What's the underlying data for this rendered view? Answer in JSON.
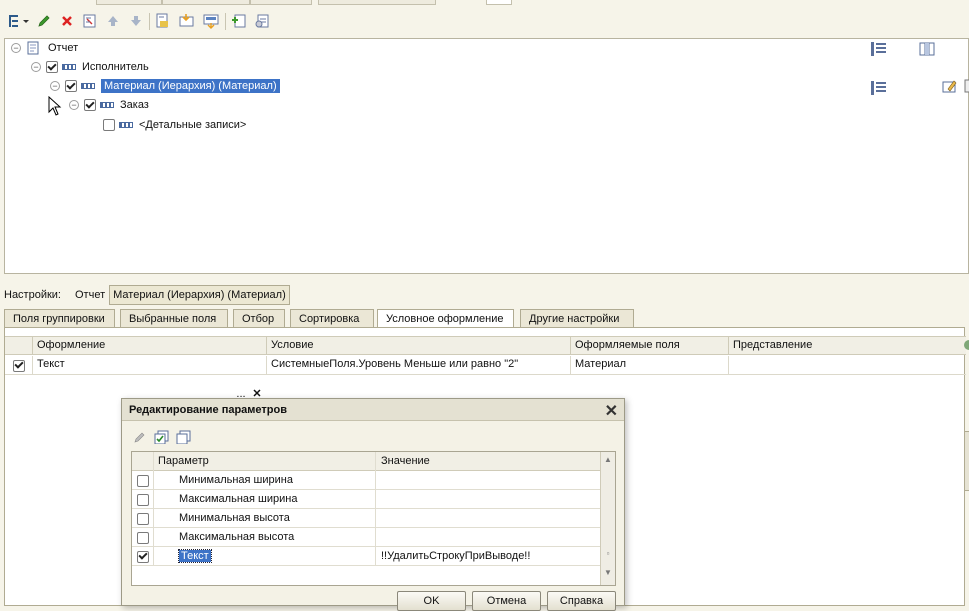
{
  "toolbar": {
    "icons": [
      "add-group-icon",
      "edit-icon",
      "delete-icon",
      "properties-icon",
      "move-up-icon",
      "move-down-icon",
      "group-icon",
      "ungroup-icon",
      "detail-icon",
      "expand-icon",
      "collapse-icon"
    ]
  },
  "tree": {
    "root": "Отчет",
    "nodes": [
      {
        "label": "Исполнитель",
        "checked": true
      },
      {
        "label": "Материал (Иерархия) (Материал)",
        "checked": true,
        "selected": true
      },
      {
        "label": "Заказ",
        "checked": true
      },
      {
        "label": "<Детальные записи>",
        "checked": false
      }
    ]
  },
  "settings": {
    "label": "Настройки:",
    "crumb1": "Отчет",
    "crumb2": "Материал (Иерархия) (Материал)"
  },
  "tabs": [
    {
      "label": "Поля группировки",
      "active": false
    },
    {
      "label": "Выбранные поля",
      "active": false
    },
    {
      "label": "Отбор",
      "active": false
    },
    {
      "label": "Сортировка",
      "active": false
    },
    {
      "label": "Условное оформление",
      "active": true
    },
    {
      "label": "Другие настройки",
      "active": false
    }
  ],
  "grid": {
    "headers": [
      "Оформление",
      "Условие",
      "Оформляемые поля",
      "Представление"
    ],
    "row": {
      "checked": true,
      "appearance": "Текст",
      "choose_btn": "...",
      "clear_btn": "✕",
      "condition": "СистемныеПоля.Уровень Меньше или равно \"2\"",
      "fields": "Материал",
      "presentation": ""
    }
  },
  "dialog": {
    "title": "Редактирование параметров",
    "close": "✕",
    "headers": [
      "Параметр",
      "Значение"
    ],
    "rows": [
      {
        "param": "Минимальная ширина",
        "value": "",
        "checked": false
      },
      {
        "param": "Максимальная ширина",
        "value": "",
        "checked": false
      },
      {
        "param": "Минимальная высота",
        "value": "",
        "checked": false
      },
      {
        "param": "Максимальная высота",
        "value": "",
        "checked": false
      },
      {
        "param": "Текст",
        "value": "!!УдалитьСтрокуПриВыводе!!",
        "checked": true,
        "selected": true
      }
    ],
    "buttons": {
      "ok": "OK",
      "cancel": "Отмена",
      "help": "Справка"
    }
  },
  "colors": {
    "selection": "#3d73c7",
    "panel": "#f6f4e9"
  }
}
